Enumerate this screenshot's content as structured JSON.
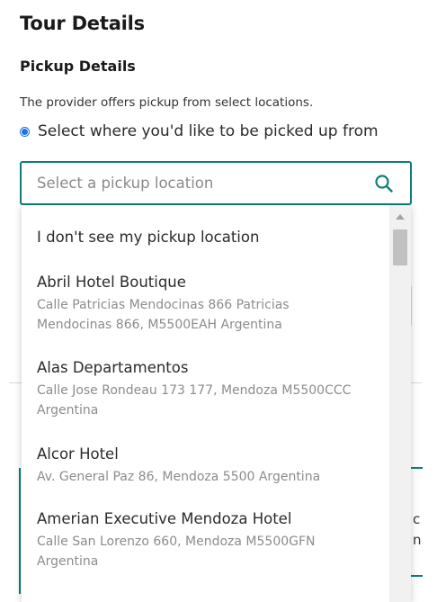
{
  "page": {
    "title": "Tour Details",
    "pickup_heading": "Pickup Details",
    "provider_note": "The provider offers pickup from select locations.",
    "radio_label": "Select where you'd like to be picked up from"
  },
  "search": {
    "placeholder": "Select a pickup location",
    "value": ""
  },
  "dropdown": {
    "options": [
      {
        "name": "I don't see my pickup location",
        "address": ""
      },
      {
        "name": "Abril Hotel Boutique",
        "address_lines": [
          "Calle Patricias Mendocinas 866 Patricias",
          "Mendocinas 866, M5500EAH Argentina"
        ]
      },
      {
        "name": "Alas Departamentos",
        "address_lines": [
          "Calle Jose Rondeau 173 177, Mendoza M5500CCC",
          "Argentina"
        ]
      },
      {
        "name": "Alcor Hotel",
        "address_lines": [
          "Av. General Paz 86, Mendoza 5500 Argentina"
        ]
      },
      {
        "name": "Amerian Executive Mendoza Hotel",
        "address_lines": [
          "Calle San Lorenzo 660, Mendoza M5500GFN",
          "Argentina"
        ]
      }
    ]
  },
  "background_fragments": {
    "frag1": "c",
    "frag2": "n"
  },
  "colors": {
    "accent_teal": "#0e7c7b",
    "radio_blue": "#1a73e8",
    "address_gray": "#8c8c8c"
  },
  "icons": {
    "search": "search-icon",
    "radio": "radio-selected-icon",
    "scroll_up": "scroll-up-arrow-icon"
  }
}
